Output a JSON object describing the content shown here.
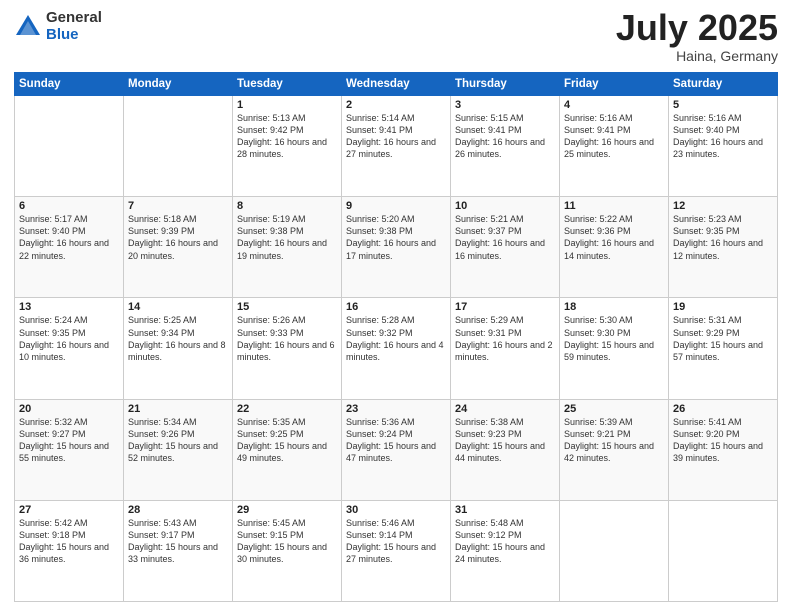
{
  "logo": {
    "general": "General",
    "blue": "Blue"
  },
  "title": "July 2025",
  "location": "Haina, Germany",
  "days_of_week": [
    "Sunday",
    "Monday",
    "Tuesday",
    "Wednesday",
    "Thursday",
    "Friday",
    "Saturday"
  ],
  "weeks": [
    [
      {
        "day": "",
        "info": ""
      },
      {
        "day": "",
        "info": ""
      },
      {
        "day": "1",
        "info": "Sunrise: 5:13 AM\nSunset: 9:42 PM\nDaylight: 16 hours\nand 28 minutes."
      },
      {
        "day": "2",
        "info": "Sunrise: 5:14 AM\nSunset: 9:41 PM\nDaylight: 16 hours\nand 27 minutes."
      },
      {
        "day": "3",
        "info": "Sunrise: 5:15 AM\nSunset: 9:41 PM\nDaylight: 16 hours\nand 26 minutes."
      },
      {
        "day": "4",
        "info": "Sunrise: 5:16 AM\nSunset: 9:41 PM\nDaylight: 16 hours\nand 25 minutes."
      },
      {
        "day": "5",
        "info": "Sunrise: 5:16 AM\nSunset: 9:40 PM\nDaylight: 16 hours\nand 23 minutes."
      }
    ],
    [
      {
        "day": "6",
        "info": "Sunrise: 5:17 AM\nSunset: 9:40 PM\nDaylight: 16 hours\nand 22 minutes."
      },
      {
        "day": "7",
        "info": "Sunrise: 5:18 AM\nSunset: 9:39 PM\nDaylight: 16 hours\nand 20 minutes."
      },
      {
        "day": "8",
        "info": "Sunrise: 5:19 AM\nSunset: 9:38 PM\nDaylight: 16 hours\nand 19 minutes."
      },
      {
        "day": "9",
        "info": "Sunrise: 5:20 AM\nSunset: 9:38 PM\nDaylight: 16 hours\nand 17 minutes."
      },
      {
        "day": "10",
        "info": "Sunrise: 5:21 AM\nSunset: 9:37 PM\nDaylight: 16 hours\nand 16 minutes."
      },
      {
        "day": "11",
        "info": "Sunrise: 5:22 AM\nSunset: 9:36 PM\nDaylight: 16 hours\nand 14 minutes."
      },
      {
        "day": "12",
        "info": "Sunrise: 5:23 AM\nSunset: 9:35 PM\nDaylight: 16 hours\nand 12 minutes."
      }
    ],
    [
      {
        "day": "13",
        "info": "Sunrise: 5:24 AM\nSunset: 9:35 PM\nDaylight: 16 hours\nand 10 minutes."
      },
      {
        "day": "14",
        "info": "Sunrise: 5:25 AM\nSunset: 9:34 PM\nDaylight: 16 hours\nand 8 minutes."
      },
      {
        "day": "15",
        "info": "Sunrise: 5:26 AM\nSunset: 9:33 PM\nDaylight: 16 hours\nand 6 minutes."
      },
      {
        "day": "16",
        "info": "Sunrise: 5:28 AM\nSunset: 9:32 PM\nDaylight: 16 hours\nand 4 minutes."
      },
      {
        "day": "17",
        "info": "Sunrise: 5:29 AM\nSunset: 9:31 PM\nDaylight: 16 hours\nand 2 minutes."
      },
      {
        "day": "18",
        "info": "Sunrise: 5:30 AM\nSunset: 9:30 PM\nDaylight: 15 hours\nand 59 minutes."
      },
      {
        "day": "19",
        "info": "Sunrise: 5:31 AM\nSunset: 9:29 PM\nDaylight: 15 hours\nand 57 minutes."
      }
    ],
    [
      {
        "day": "20",
        "info": "Sunrise: 5:32 AM\nSunset: 9:27 PM\nDaylight: 15 hours\nand 55 minutes."
      },
      {
        "day": "21",
        "info": "Sunrise: 5:34 AM\nSunset: 9:26 PM\nDaylight: 15 hours\nand 52 minutes."
      },
      {
        "day": "22",
        "info": "Sunrise: 5:35 AM\nSunset: 9:25 PM\nDaylight: 15 hours\nand 49 minutes."
      },
      {
        "day": "23",
        "info": "Sunrise: 5:36 AM\nSunset: 9:24 PM\nDaylight: 15 hours\nand 47 minutes."
      },
      {
        "day": "24",
        "info": "Sunrise: 5:38 AM\nSunset: 9:23 PM\nDaylight: 15 hours\nand 44 minutes."
      },
      {
        "day": "25",
        "info": "Sunrise: 5:39 AM\nSunset: 9:21 PM\nDaylight: 15 hours\nand 42 minutes."
      },
      {
        "day": "26",
        "info": "Sunrise: 5:41 AM\nSunset: 9:20 PM\nDaylight: 15 hours\nand 39 minutes."
      }
    ],
    [
      {
        "day": "27",
        "info": "Sunrise: 5:42 AM\nSunset: 9:18 PM\nDaylight: 15 hours\nand 36 minutes."
      },
      {
        "day": "28",
        "info": "Sunrise: 5:43 AM\nSunset: 9:17 PM\nDaylight: 15 hours\nand 33 minutes."
      },
      {
        "day": "29",
        "info": "Sunrise: 5:45 AM\nSunset: 9:15 PM\nDaylight: 15 hours\nand 30 minutes."
      },
      {
        "day": "30",
        "info": "Sunrise: 5:46 AM\nSunset: 9:14 PM\nDaylight: 15 hours\nand 27 minutes."
      },
      {
        "day": "31",
        "info": "Sunrise: 5:48 AM\nSunset: 9:12 PM\nDaylight: 15 hours\nand 24 minutes."
      },
      {
        "day": "",
        "info": ""
      },
      {
        "day": "",
        "info": ""
      }
    ]
  ]
}
